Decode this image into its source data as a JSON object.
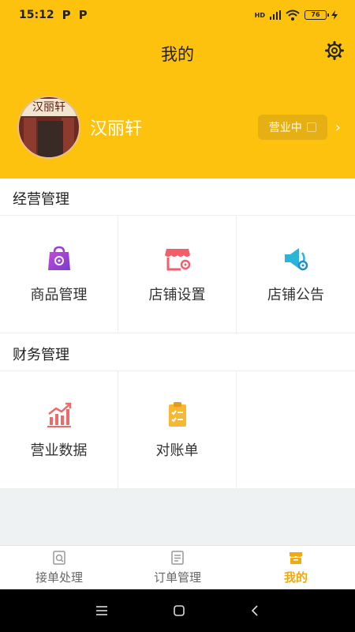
{
  "status_bar": {
    "time": "15:12",
    "badge1": "P",
    "badge2": "P",
    "network": "HD",
    "battery": "76"
  },
  "header": {
    "title": "我的"
  },
  "profile": {
    "shop_name": "汉丽轩",
    "avatar_sign": "汉丽轩",
    "status": "营业中"
  },
  "business": {
    "title": "经营管理",
    "items": [
      {
        "label": "商品管理",
        "icon": "product-bag-icon"
      },
      {
        "label": "店铺设置",
        "icon": "store-settings-icon"
      },
      {
        "label": "店铺公告",
        "icon": "announcement-icon"
      }
    ]
  },
  "finance": {
    "title": "财务管理",
    "items": [
      {
        "label": "营业数据",
        "icon": "chart-icon"
      },
      {
        "label": "对账单",
        "icon": "statement-icon"
      }
    ]
  },
  "tabs": [
    {
      "label": "接单处理",
      "icon": "orders-icon"
    },
    {
      "label": "订单管理",
      "icon": "list-icon"
    },
    {
      "label": "我的",
      "icon": "store-icon",
      "active": true
    }
  ],
  "colors": {
    "brand": "#fdc20d",
    "active_tab": "#f1a90d"
  }
}
